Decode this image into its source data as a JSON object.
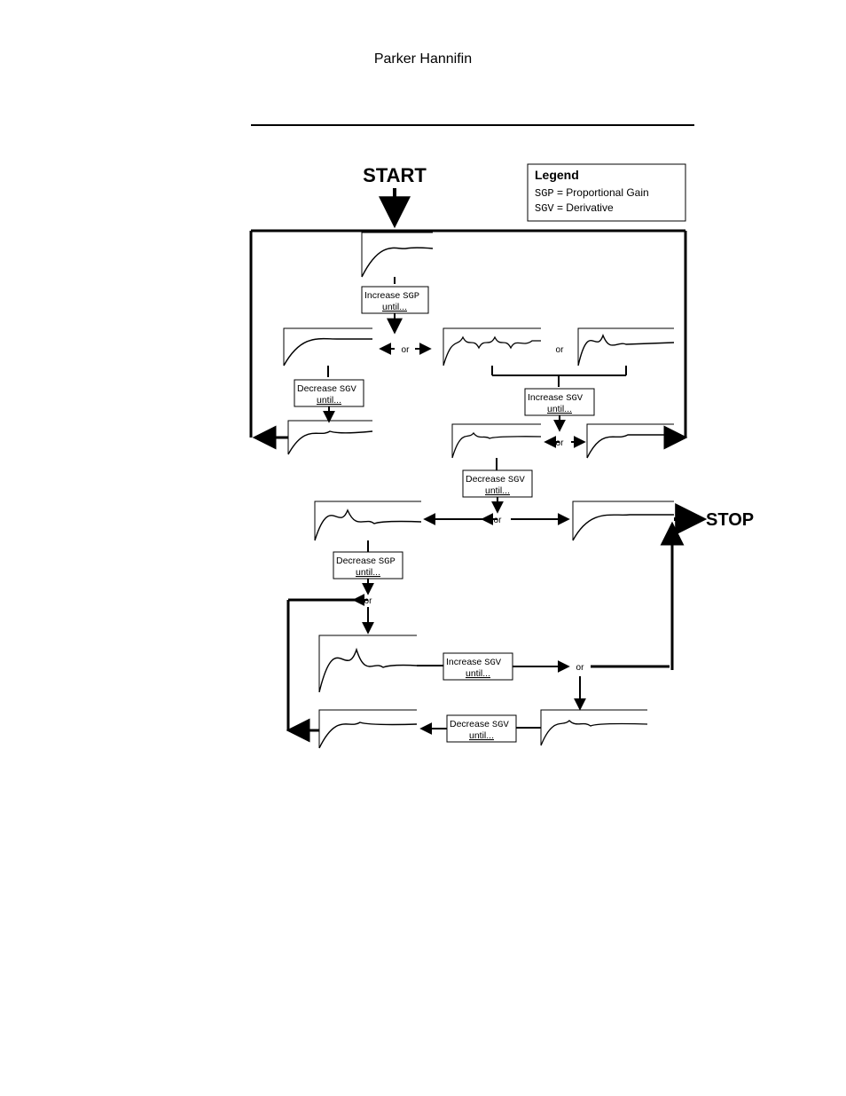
{
  "header": {
    "title": "Parker Hannifin"
  },
  "diagram": {
    "start": "START",
    "stop": "STOP",
    "legend": {
      "title": "Legend",
      "row1_code": "SGP",
      "row1_eq": " = Proportional Gain",
      "row2_code": "SGV",
      "row2_eq": " = Derivative"
    },
    "boxes": {
      "inc_sgp": {
        "l1": "Increase ",
        "code": "SGP",
        "l2": "until..."
      },
      "dec_sgv_1": {
        "l1": "Decrease ",
        "code": "SGV",
        "l2": "until..."
      },
      "inc_sgv": {
        "l1": "Increase ",
        "code": "SGV",
        "l2": "until..."
      },
      "dec_sgv_2": {
        "l1": "Decrease ",
        "code": "SGV",
        "l2": "until..."
      },
      "dec_sgp": {
        "l1": "Decrease ",
        "code": "SGP",
        "l2": "until..."
      },
      "inc_sgv2": {
        "l1": "Increase ",
        "code": "SGV",
        "l2": "until..."
      },
      "dec_sgv_3": {
        "l1": "Decrease ",
        "code": "SGV",
        "l2": "until..."
      }
    },
    "or": "or"
  }
}
